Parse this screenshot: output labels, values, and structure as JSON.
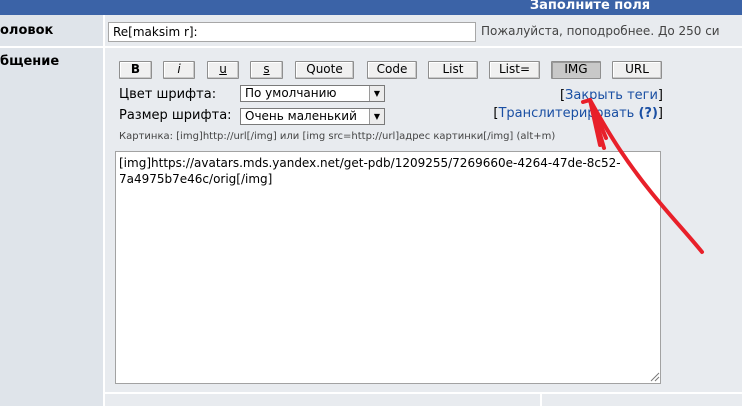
{
  "header": {
    "title": "Заполните поля"
  },
  "labels": {
    "subject": "оловок",
    "message": "бщение"
  },
  "subject": {
    "value": "Re[maksim r]:",
    "hint": "Пожалуйста, поподробнее. До 250 си"
  },
  "toolbar": {
    "buttons": [
      "B",
      "i",
      "u",
      "s",
      "Quote",
      "Code",
      "List",
      "List=",
      "IMG",
      "URL"
    ],
    "active": "IMG"
  },
  "font": {
    "color_label": "Цвет шрифта:",
    "color_value": "По умолчанию",
    "size_label": "Размер шрифта:",
    "size_value": "Очень маленький"
  },
  "links": {
    "close_tags": "Закрыть теги",
    "transliterate": "Транслитерировать",
    "help": "(?)"
  },
  "img_hint": "Картинка: [img]http://url[/img] или [img src=http://url]адрес картинки[/img] (alt+m)",
  "message_text": "[img]https://avatars.mds.yandex.net/get-pdb/1209255/7269660e-4264-47de-8c52-7a4975b7e46c/orig[/img]",
  "colors": {
    "header": "#3b63a7",
    "link": "#1a4fa3",
    "arrow": "#e8202a"
  }
}
